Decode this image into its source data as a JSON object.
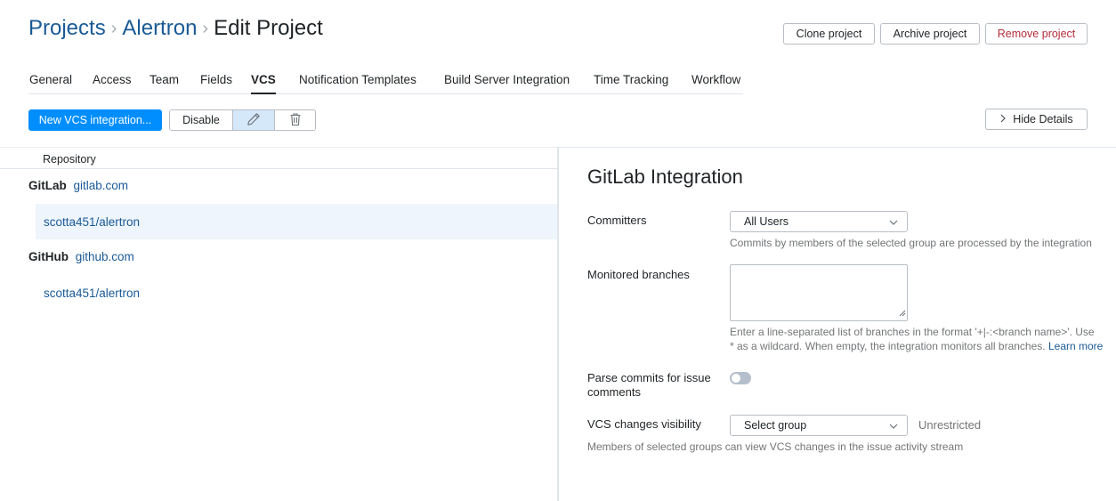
{
  "breadcrumb": {
    "projects": "Projects",
    "project": "Alertron",
    "current": "Edit Project",
    "separator": "›"
  },
  "header_buttons": {
    "clone": "Clone project",
    "archive": "Archive project",
    "remove": "Remove project"
  },
  "tabs": [
    {
      "label": "General"
    },
    {
      "label": "Access"
    },
    {
      "label": "Team"
    },
    {
      "label": "Fields"
    },
    {
      "label": "VCS",
      "active": true
    },
    {
      "label": "Notification Templates"
    },
    {
      "label": "Build Server Integration"
    },
    {
      "label": "Time Tracking"
    },
    {
      "label": "Workflow"
    }
  ],
  "toolbar": {
    "new_integration": "New VCS integration...",
    "disable": "Disable",
    "edit_icon": "pencil-icon",
    "delete_icon": "trash-icon",
    "hide_details": "Hide Details",
    "hide_details_icon": "chevron-right-icon"
  },
  "list": {
    "header": "Repository",
    "groups": [
      {
        "name": "GitLab",
        "host": "gitlab.com",
        "repos": [
          {
            "name": "scotta451/alertron",
            "selected": true
          }
        ]
      },
      {
        "name": "GitHub",
        "host": "github.com",
        "repos": [
          {
            "name": "scotta451/alertron",
            "selected": false
          }
        ]
      }
    ]
  },
  "details": {
    "title": "GitLab Integration",
    "committers": {
      "label": "Committers",
      "value": "All Users",
      "hint": "Commits by members of the selected group are processed by the integration"
    },
    "monitored_branches": {
      "label": "Monitored branches",
      "value": "",
      "hint_line1": "Enter a line-separated list of branches in the format '+|-:<branch name>'. Use",
      "hint_line2": "* as a wildcard. When empty, the integration monitors all branches.",
      "learn_more": "Learn more"
    },
    "parse_commits": {
      "label_line1": "Parse commits for issue",
      "label_line2": "comments",
      "enabled": false
    },
    "visibility": {
      "label": "VCS changes visibility",
      "value": "Select group",
      "status": "Unrestricted",
      "hint": "Members of selected groups can view VCS changes in the issue activity stream"
    }
  },
  "colors": {
    "primary": "#008eff",
    "link": "#1a5a96",
    "danger": "#b32d3b",
    "selected_row": "#eef5fc",
    "toggle_off": "#b4bfcb"
  }
}
